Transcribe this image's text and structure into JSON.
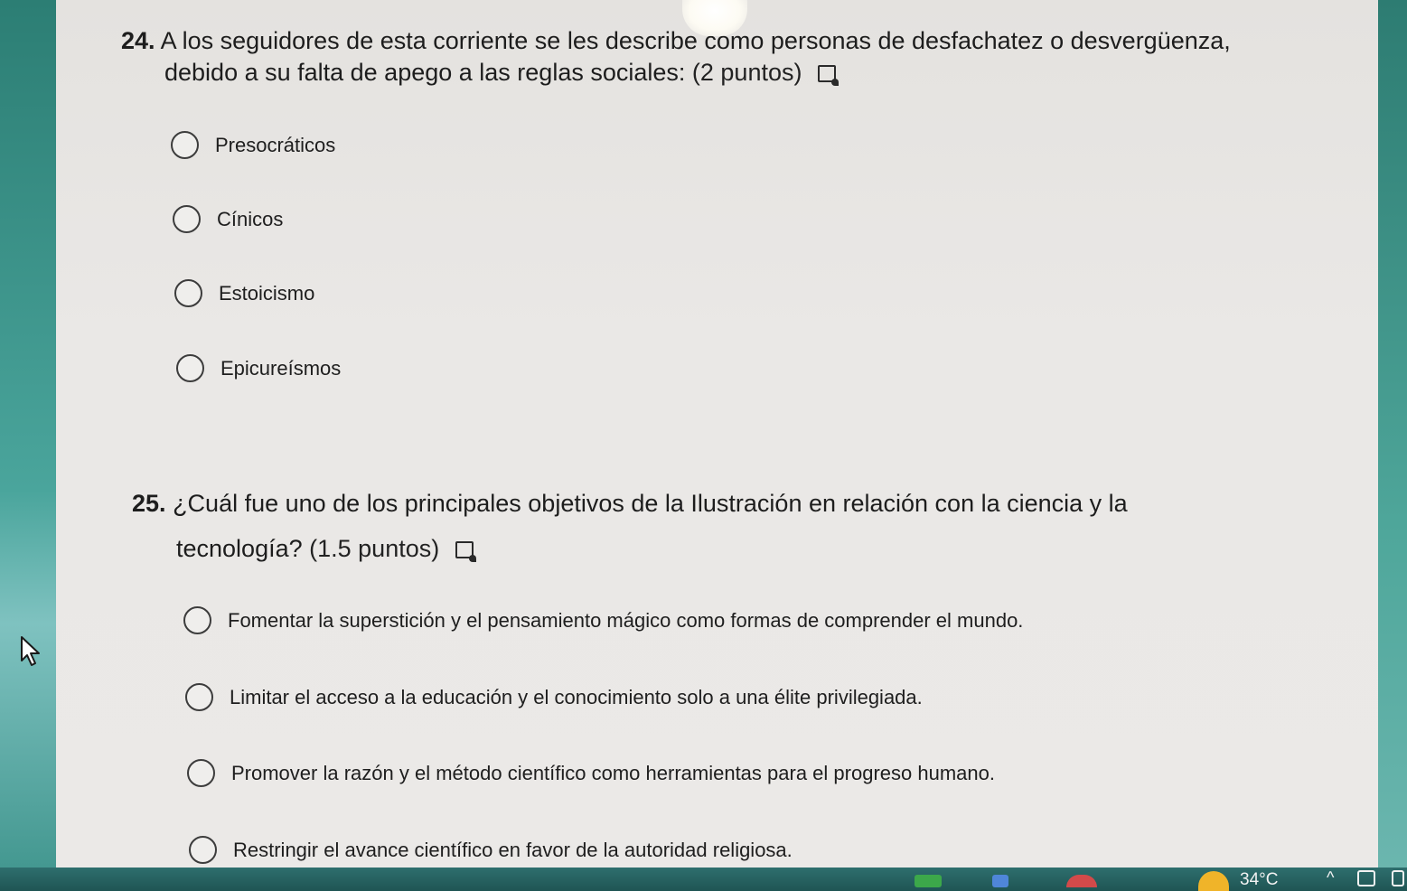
{
  "questions": [
    {
      "number": "24.",
      "text_line1": "A los seguidores de esta corriente se les describe como personas de desfachatez o desvergüenza,",
      "text_line2": "debido a su falta de apego a las reglas sociales:",
      "points": "(2 puntos)",
      "reader_icon": "immersive-reader-icon",
      "options": [
        "Presocráticos",
        "Cínicos",
        "Estoicismo",
        "Epicureísmos"
      ]
    },
    {
      "number": "25.",
      "text_line1": "¿Cuál fue uno de los principales objetivos de la Ilustración en relación con la ciencia y la",
      "text_line2": "tecnología?",
      "points": "(1.5 puntos)",
      "reader_icon": "immersive-reader-icon",
      "options": [
        "Fomentar la superstición y el pensamiento mágico como formas de comprender el mundo.",
        "Limitar el acceso a la educación y el conocimiento solo a una élite privilegiada.",
        "Promover la razón y el método científico como herramientas para el progreso humano.",
        "Restringir el avance científico en favor de la autoridad religiosa."
      ]
    }
  ],
  "taskbar": {
    "temperature": "34°C",
    "weather_icon": "sunny-weather-icon",
    "tray_chevron": "^"
  },
  "colors": {
    "page_bg": "#ebe9e7",
    "desktop_bg": "#3f9a8c",
    "text": "#1d1d1d",
    "weather_sun": "#f0b429"
  }
}
